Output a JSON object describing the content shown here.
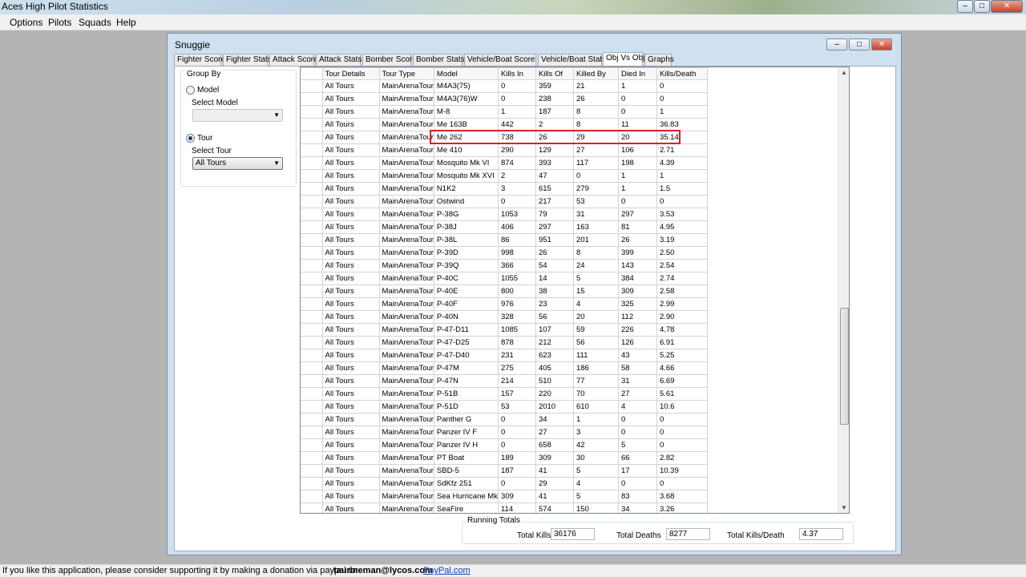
{
  "app": {
    "title": "Aces High Pilot Statistics",
    "minimize_icon": "minimize-icon",
    "maximize_icon": "maximize-icon",
    "close_icon": "close-icon"
  },
  "menu": [
    "Options",
    "Pilots",
    "Squads",
    "Help"
  ],
  "window": {
    "title": "Snuggie"
  },
  "tabs": [
    "Fighter Score",
    "Fighter Stats",
    "Attack Score",
    "Attack Stats",
    "Bomber Score",
    "Bomber Stats",
    "Vehicle/Boat Score",
    "Vehicle/Boat Stats",
    "Obj Vs Obj",
    "Graphs"
  ],
  "active_tab": "Obj Vs Obj",
  "group_by": {
    "label": "Group By",
    "model_label": "Model",
    "select_model_label": "Select Model",
    "select_model_value": "",
    "tour_label": "Tour",
    "select_tour_label": "Select Tour",
    "select_tour_value": "All Tours",
    "selected": "Tour"
  },
  "grid": {
    "columns": [
      "Tour Details",
      "Tour Type",
      "Model",
      "Kills In",
      "Kills Of",
      "Killed By",
      "Died In",
      "Kills/Death"
    ],
    "rows": [
      [
        "All Tours",
        "MainArenaTour",
        "M4A3(75)",
        "0",
        "359",
        "21",
        "1",
        "0"
      ],
      [
        "All Tours",
        "MainArenaTour",
        "M4A3(76)W",
        "0",
        "238",
        "26",
        "0",
        "0"
      ],
      [
        "All Tours",
        "MainArenaTour",
        "M-8",
        "1",
        "187",
        "8",
        "0",
        "1"
      ],
      [
        "All Tours",
        "MainArenaTour",
        "Me 163B",
        "442",
        "2",
        "8",
        "11",
        "36.83"
      ],
      [
        "All Tours",
        "MainArenaTour",
        "Me 262",
        "738",
        "26",
        "29",
        "20",
        "35.14"
      ],
      [
        "All Tours",
        "MainArenaTour",
        "Me 410",
        "290",
        "129",
        "27",
        "106",
        "2.71"
      ],
      [
        "All Tours",
        "MainArenaTour",
        "Mosquito Mk VI",
        "874",
        "393",
        "117",
        "198",
        "4.39"
      ],
      [
        "All Tours",
        "MainArenaTour",
        "Mosquito Mk XVI",
        "2",
        "47",
        "0",
        "1",
        "1"
      ],
      [
        "All Tours",
        "MainArenaTour",
        "N1K2",
        "3",
        "615",
        "279",
        "1",
        "1.5"
      ],
      [
        "All Tours",
        "MainArenaTour",
        "Ostwind",
        "0",
        "217",
        "53",
        "0",
        "0"
      ],
      [
        "All Tours",
        "MainArenaTour",
        "P-38G",
        "1053",
        "79",
        "31",
        "297",
        "3.53"
      ],
      [
        "All Tours",
        "MainArenaTour",
        "P-38J",
        "406",
        "297",
        "163",
        "81",
        "4.95"
      ],
      [
        "All Tours",
        "MainArenaTour",
        "P-38L",
        "86",
        "951",
        "201",
        "26",
        "3.19"
      ],
      [
        "All Tours",
        "MainArenaTour",
        "P-39D",
        "998",
        "26",
        "8",
        "399",
        "2.50"
      ],
      [
        "All Tours",
        "MainArenaTour",
        "P-39Q",
        "366",
        "54",
        "24",
        "143",
        "2.54"
      ],
      [
        "All Tours",
        "MainArenaTour",
        "P-40C",
        "1055",
        "14",
        "5",
        "384",
        "2.74"
      ],
      [
        "All Tours",
        "MainArenaTour",
        "P-40E",
        "800",
        "38",
        "15",
        "309",
        "2.58"
      ],
      [
        "All Tours",
        "MainArenaTour",
        "P-40F",
        "976",
        "23",
        "4",
        "325",
        "2.99"
      ],
      [
        "All Tours",
        "MainArenaTour",
        "P-40N",
        "328",
        "56",
        "20",
        "112",
        "2.90"
      ],
      [
        "All Tours",
        "MainArenaTour",
        "P-47-D11",
        "1085",
        "107",
        "59",
        "226",
        "4.78"
      ],
      [
        "All Tours",
        "MainArenaTour",
        "P-47-D25",
        "878",
        "212",
        "56",
        "126",
        "6.91"
      ],
      [
        "All Tours",
        "MainArenaTour",
        "P-47-D40",
        "231",
        "623",
        "111",
        "43",
        "5.25"
      ],
      [
        "All Tours",
        "MainArenaTour",
        "P-47M",
        "275",
        "405",
        "186",
        "58",
        "4.66"
      ],
      [
        "All Tours",
        "MainArenaTour",
        "P-47N",
        "214",
        "510",
        "77",
        "31",
        "6.69"
      ],
      [
        "All Tours",
        "MainArenaTour",
        "P-51B",
        "157",
        "220",
        "70",
        "27",
        "5.61"
      ],
      [
        "All Tours",
        "MainArenaTour",
        "P-51D",
        "53",
        "2010",
        "610",
        "4",
        "10.6"
      ],
      [
        "All Tours",
        "MainArenaTour",
        "Panther G",
        "0",
        "34",
        "1",
        "0",
        "0"
      ],
      [
        "All Tours",
        "MainArenaTour",
        "Panzer IV F",
        "0",
        "27",
        "3",
        "0",
        "0"
      ],
      [
        "All Tours",
        "MainArenaTour",
        "Panzer IV H",
        "0",
        "658",
        "42",
        "5",
        "0"
      ],
      [
        "All Tours",
        "MainArenaTour",
        "PT Boat",
        "189",
        "309",
        "30",
        "66",
        "2.82"
      ],
      [
        "All Tours",
        "MainArenaTour",
        "SBD-5",
        "187",
        "41",
        "5",
        "17",
        "10.39"
      ],
      [
        "All Tours",
        "MainArenaTour",
        "SdKfz 251",
        "0",
        "29",
        "4",
        "0",
        "0"
      ],
      [
        "All Tours",
        "MainArenaTour",
        "Sea Hurricane Mk",
        "309",
        "41",
        "5",
        "83",
        "3.68"
      ],
      [
        "All Tours",
        "MainArenaTour",
        "SeaFire",
        "114",
        "574",
        "150",
        "34",
        "3.26"
      ]
    ],
    "highlighted_row": "Me 262",
    "highlight_color": "#d9202a"
  },
  "totals": {
    "label": "Running Totals",
    "kills_label": "Total Kills",
    "kills_value": "36176",
    "deaths_label": "Total Deaths",
    "deaths_value": "8277",
    "kd_label": "Total Kills/Death",
    "kd_value": "4.37"
  },
  "status": {
    "text": "If you like this application, please consider supporting it by making a donation via paypal to:",
    "email": "taurineman@lycos.com",
    "link": "PayPal.com"
  }
}
